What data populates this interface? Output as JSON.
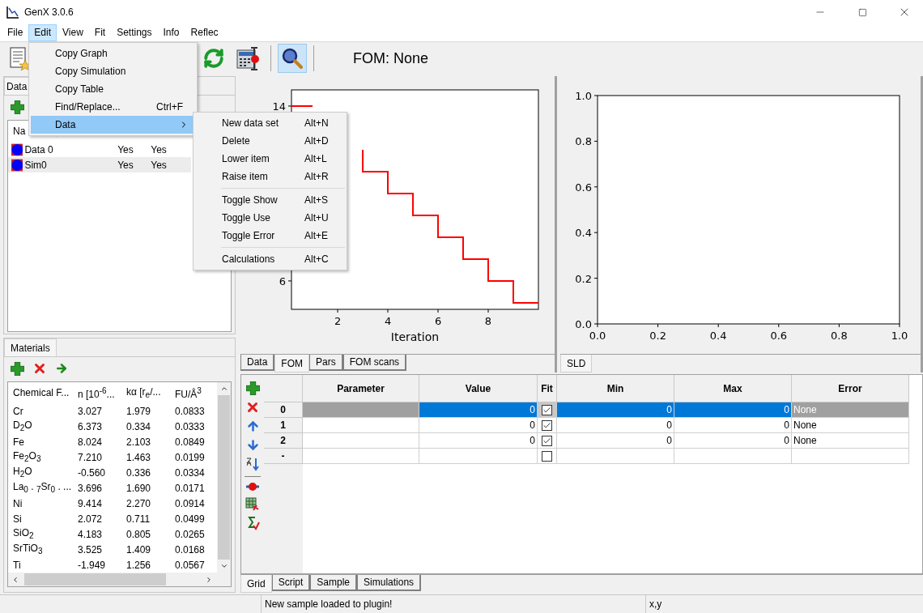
{
  "window": {
    "title": "GenX 3.0.6"
  },
  "menu_bar": [
    {
      "label": "File",
      "selected": false
    },
    {
      "label": "Edit",
      "selected": true
    },
    {
      "label": "View",
      "selected": false
    },
    {
      "label": "Fit",
      "selected": false
    },
    {
      "label": "Settings",
      "selected": false
    },
    {
      "label": "Info",
      "selected": false
    },
    {
      "label": "Reflec",
      "selected": false
    }
  ],
  "toolbar": {
    "zoom_pressed": true,
    "fom_label": "FOM: None"
  },
  "data_panel": {
    "tabs": [
      {
        "label": "Data",
        "selected": true
      }
    ],
    "columns": [
      "Na"
    ],
    "rows": [
      {
        "name": "Data 0",
        "column_2": "Yes",
        "column_3": "Yes",
        "selected": false
      },
      {
        "name": "Sim0",
        "column_2": "Yes",
        "column_3": "Yes",
        "selected": true
      }
    ]
  },
  "materials_panel": {
    "tabs": [
      {
        "label": "Materials",
        "selected": true
      }
    ],
    "columns": [
      "Chemical F...",
      "n [10$^{-6}$...",
      "kα [r$_{e}$/...",
      "FU/Å$^{3}$"
    ],
    "rows": [
      [
        "Cr",
        "3.027",
        "1.979",
        "0.0833"
      ],
      [
        "D$_{2}$O",
        "6.373",
        "0.334",
        "0.0333"
      ],
      [
        "Fe",
        "8.024",
        "2.103",
        "0.0849"
      ],
      [
        "Fe$_{2}$O$_{3}$",
        "7.210",
        "1.463",
        "0.0199"
      ],
      [
        "H$_{2}$O",
        "-0.560",
        "0.336",
        "0.0334"
      ],
      [
        "La$_{0}$ . $_{7}$Sr$_{0}$ . ...",
        "3.696",
        "1.690",
        "0.0171"
      ],
      [
        "Ni",
        "9.414",
        "2.270",
        "0.0914"
      ],
      [
        "Si",
        "2.072",
        "0.711",
        "0.0499"
      ],
      [
        "SiO$_{2}$",
        "4.183",
        "0.805",
        "0.0265"
      ],
      [
        "SrTiO$_{3}$",
        "3.525",
        "1.409",
        "0.0168"
      ],
      [
        "Ti",
        "-1.949",
        "1.256",
        "0.0567"
      ]
    ]
  },
  "plot_panel": {
    "chart_data": {
      "type": "line",
      "xlabel": "Iteration",
      "x": [
        0.16,
        1,
        null,
        null,
        null,
        3,
        3,
        4,
        4,
        5,
        5,
        6,
        6,
        7,
        7,
        8,
        8,
        9,
        9,
        10
      ],
      "series": [
        {
          "color": "#ff0000",
          "values": [
            14,
            14,
            null,
            null,
            null,
            12,
            11,
            11,
            10,
            10,
            9,
            9,
            8,
            8,
            7,
            7,
            6,
            6,
            5,
            5
          ]
        }
      ],
      "xlim": [
        0.16,
        10
      ],
      "ylim": [
        4.7,
        14.74
      ],
      "xticks": [
        2,
        4,
        6,
        8
      ],
      "yticks": [
        6,
        14
      ]
    },
    "tabs": [
      {
        "label": "Data",
        "selected": false
      },
      {
        "label": "FOM",
        "selected": true
      },
      {
        "label": "Pars",
        "selected": false
      },
      {
        "label": "FOM scans",
        "selected": false
      }
    ]
  },
  "sld_panel": {
    "chart_data": {
      "type": "line",
      "xlim": [
        0,
        1
      ],
      "ylim": [
        0,
        1
      ],
      "xticks": [
        {
          "value": 0,
          "label": "0.0"
        },
        {
          "value": 0.2,
          "label": "0.2"
        },
        {
          "value": 0.4,
          "label": "0.4"
        },
        {
          "value": 0.6,
          "label": "0.6"
        },
        {
          "value": 0.8,
          "label": "0.8"
        },
        {
          "value": 1,
          "label": "1.0"
        }
      ],
      "yticks": [
        {
          "value": 0,
          "label": "0.0"
        },
        {
          "value": 0.2,
          "label": "0.2"
        },
        {
          "value": 0.4,
          "label": "0.4"
        },
        {
          "value": 0.6,
          "label": "0.6"
        },
        {
          "value": 0.8,
          "label": "0.8"
        },
        {
          "value": 1,
          "label": "1.0"
        }
      ]
    },
    "tabs": [
      {
        "label": "SLD",
        "selected": true
      }
    ]
  },
  "parameter_grid": {
    "columns": [
      "Parameter",
      "Value",
      "Fit",
      "Min",
      "Max",
      "Error"
    ],
    "rows": [
      {
        "label": "0",
        "selected": true,
        "value": "0",
        "fit": true,
        "min": "0",
        "max": "0",
        "error": "None"
      },
      {
        "label": "1",
        "selected": false,
        "value": "0",
        "fit": true,
        "min": "0",
        "max": "0",
        "error": "None"
      },
      {
        "label": "2",
        "selected": false,
        "value": "0",
        "fit": true,
        "min": "0",
        "max": "0",
        "error": "None"
      },
      {
        "label": "-",
        "selected": false,
        "fit": false
      }
    ]
  },
  "bottom_tabs": [
    {
      "label": "Grid",
      "selected": true
    },
    {
      "label": "Script",
      "selected": false
    },
    {
      "label": "Sample",
      "selected": false
    },
    {
      "label": "Simulations",
      "selected": false
    }
  ],
  "status_bar": [
    "New sample loaded to plugin!",
    "x,y"
  ],
  "edit_menu": [
    {
      "kind": "item",
      "label": "Copy Graph",
      "selected": false
    },
    {
      "kind": "item",
      "label": "Copy Simulation",
      "selected": false
    },
    {
      "kind": "item",
      "label": "Copy Table",
      "selected": false
    },
    {
      "kind": "item",
      "label": "Find/Replace...",
      "shortcut": "Ctrl+F",
      "selected": false
    },
    {
      "kind": "submenu",
      "label": "Data",
      "selected": true
    }
  ],
  "data_submenu": [
    {
      "kind": "item",
      "label": "New data set",
      "shortcut": "Alt+N"
    },
    {
      "kind": "item",
      "label": "Delete",
      "shortcut": "Alt+D"
    },
    {
      "kind": "item",
      "label": "Lower item",
      "shortcut": "Alt+L"
    },
    {
      "kind": "item",
      "label": "Raise item",
      "shortcut": "Alt+R"
    },
    {
      "kind": "separator"
    },
    {
      "kind": "item",
      "label": "Toggle Show",
      "shortcut": "Alt+S"
    },
    {
      "kind": "item",
      "label": "Toggle Use",
      "shortcut": "Alt+U"
    },
    {
      "kind": "item",
      "label": "Toggle Error",
      "shortcut": "Alt+E"
    },
    {
      "kind": "separator"
    },
    {
      "kind": "item",
      "label": "Calculations",
      "shortcut": "Alt+C"
    }
  ]
}
